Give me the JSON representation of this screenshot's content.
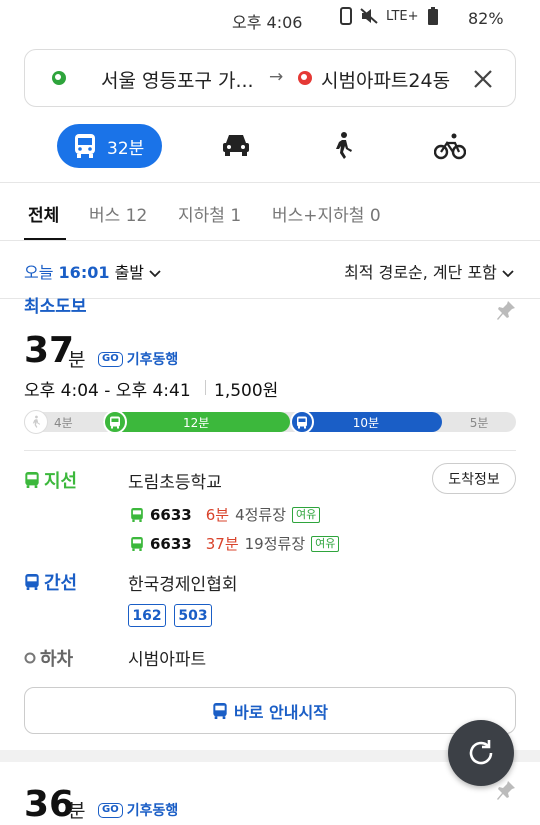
{
  "status_bar": {
    "time": "오후 4:06",
    "network": "LTE+",
    "battery": "82%"
  },
  "search": {
    "origin": "서울 영등포구 가...",
    "arrow": "→",
    "destination": "시범아파트24동"
  },
  "modes": {
    "bus_label": "32분"
  },
  "filter_tabs": [
    {
      "label": "전체"
    },
    {
      "label": "버스 12"
    },
    {
      "label": "지하철 1"
    },
    {
      "label": "버스+지하철 0"
    }
  ],
  "depart": {
    "day": "오늘",
    "time": "16:01",
    "suffix": "출발"
  },
  "sort": {
    "label": "최적 경로순, 계단 포함"
  },
  "route": {
    "badge": "최소도보",
    "duration_num": "37",
    "duration_unit": "분",
    "climate_badge": "GO",
    "climate_label": "기후동행",
    "time_range": "오후 4:04 - 오후 4:41",
    "fare": "1,500원",
    "timeline": [
      {
        "type": "walk",
        "label": "4분",
        "fraction": 0.16
      },
      {
        "type": "branch_bus",
        "label": "12분",
        "fraction": 0.38
      },
      {
        "type": "trunk_bus",
        "label": "10분",
        "fraction": 0.31
      },
      {
        "type": "walk",
        "label": "5분",
        "fraction": 0.15
      }
    ],
    "stages": {
      "branch": {
        "label": "지선",
        "stop": "도림초등학교",
        "arrival_button": "도착정보",
        "buses": [
          {
            "number": "6633",
            "eta": "6분",
            "stops": "4정류장",
            "status": "여유"
          },
          {
            "number": "6633",
            "eta": "37분",
            "stops": "19정류장",
            "status": "여유"
          }
        ]
      },
      "trunk": {
        "label": "간선",
        "stop": "한국경제인협회",
        "routes": [
          "162",
          "503"
        ]
      },
      "alight": {
        "label": "하차",
        "stop": "시범아파트"
      }
    },
    "start_button": "바로 안내시작"
  },
  "next_route": {
    "duration_num": "36",
    "duration_unit": "분",
    "climate_badge": "GO",
    "climate_label": "기후동행"
  },
  "colors": {
    "accent": "#1a73e8",
    "branch_green": "#3cb83c",
    "trunk_blue": "#1a5ec6",
    "eta_red": "#d9432b"
  }
}
